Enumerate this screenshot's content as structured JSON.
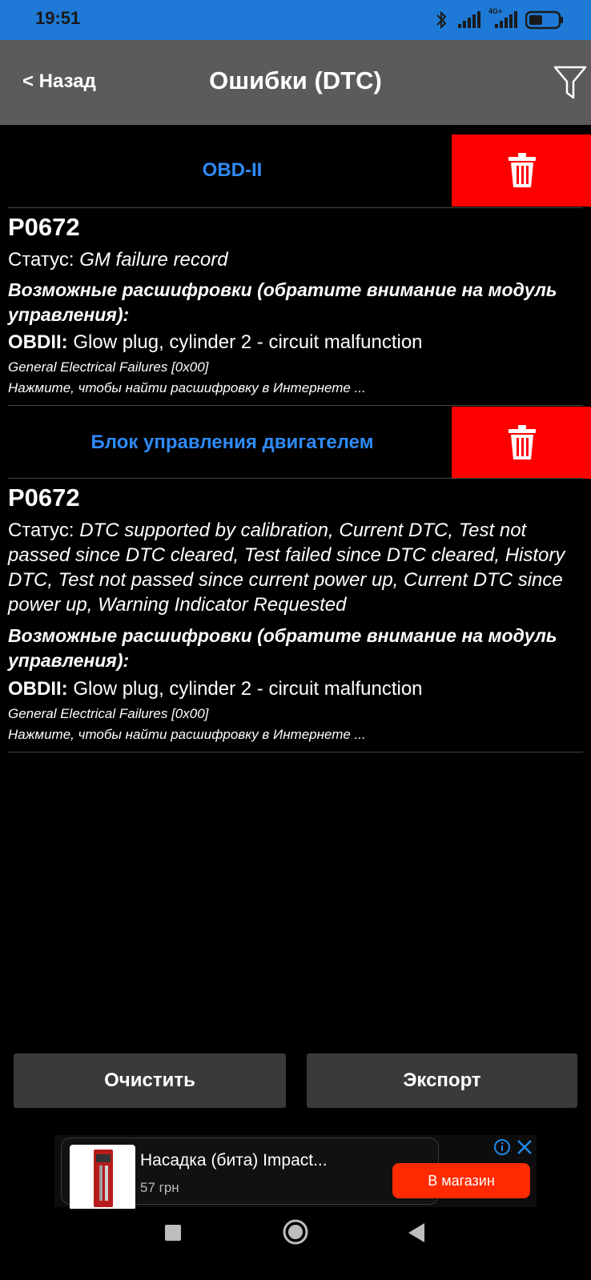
{
  "status_bar": {
    "time": "19:51",
    "network_label": "4G+",
    "icons": [
      "bluetooth-icon",
      "signal-icon",
      "signal-4g-icon",
      "battery-icon"
    ]
  },
  "header": {
    "back_label": "< Назад",
    "title": "Ошибки (DTC)",
    "filter_icon": "filter-icon"
  },
  "sections": [
    {
      "title": "OBD-II",
      "delete_icon": "trash-icon",
      "code": "P0672",
      "status_label": "Статус: ",
      "status_value": "GM failure record",
      "hint": "Возможные расшифровки (обратите внимание на модуль управления):",
      "obd_label": "OBDII:",
      "obd_text": " Glow plug, cylinder 2 - circuit malfunction",
      "failure_type": "General Electrical Failures [0x00]",
      "search_link": "Нажмите, чтобы найти расшифровку в Интернете ..."
    },
    {
      "title": "Блок управления двигателем",
      "delete_icon": "trash-icon",
      "code": "P0672",
      "status_label": "Статус: ",
      "status_value": "DTC supported by calibration, Current DTC, Test not passed since DTC cleared, Test failed since DTC cleared, History DTC, Test not passed since current power up, Current DTC since power up, Warning Indicator Requested",
      "hint": "Возможные расшифровки (обратите внимание на модуль управления):",
      "obd_label": "OBDII:",
      "obd_text": " Glow plug, cylinder 2 - circuit malfunction",
      "failure_type": "General Electrical Failures [0x00]",
      "search_link": "Нажмите, чтобы найти расшифровку в Интернете ..."
    }
  ],
  "actions": {
    "clear_label": "Очистить",
    "export_label": "Экспорт"
  },
  "ad": {
    "title": "Насадка (бита) Impact...",
    "price": "57 грн",
    "cta": "В магазин",
    "info_icon": "info-icon",
    "close_icon": "close-icon"
  },
  "navbar": {
    "icons": [
      "recents-square-icon",
      "home-circle-icon",
      "back-triangle-icon"
    ]
  },
  "colors": {
    "status_bar": "#1e7ad6",
    "header": "#5b5b5b",
    "section_title": "#2f8af5",
    "delete": "#ff0000",
    "ad_cta": "#ff2a00"
  }
}
